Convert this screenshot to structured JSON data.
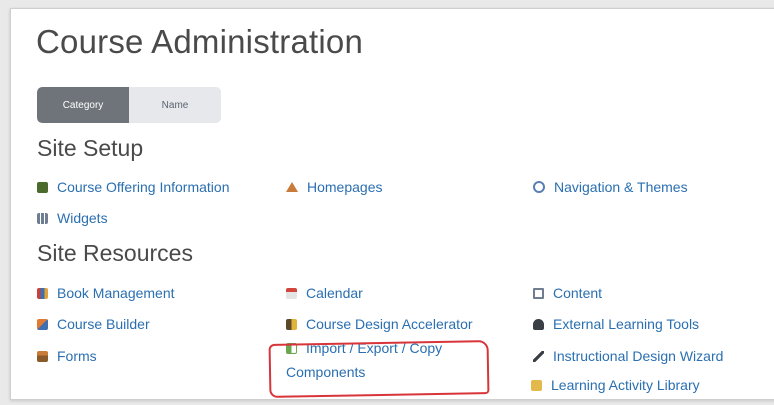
{
  "header": {
    "title": "Course Administration"
  },
  "view_toggle": {
    "category_label": "Category",
    "name_label": "Name",
    "active": "Category"
  },
  "sections": {
    "site_setup": {
      "title": "Site Setup",
      "items": {
        "course_offering": "Course Offering Information",
        "homepages": "Homepages",
        "navigation": "Navigation & Themes",
        "widgets": "Widgets"
      }
    },
    "site_resources": {
      "title": "Site Resources",
      "items": {
        "book_management": "Book Management",
        "calendar": "Calendar",
        "content": "Content",
        "course_builder": "Course Builder",
        "course_design_accelerator": "Course Design Accelerator",
        "external_learning_tools": "External Learning Tools",
        "forms": "Forms",
        "import_export_copy_line1": "Import / Export / Copy",
        "import_export_copy_line2": "Components",
        "instructional_design_wizard": "Instructional Design Wizard",
        "learning_activity_library": "Learning Activity Library"
      }
    }
  },
  "icons": {
    "course_offering": "book-icon",
    "homepages": "home-icon",
    "navigation": "compass-icon",
    "widgets": "grid-icon",
    "book_management": "books-icon",
    "calendar": "calendar-icon",
    "content": "content-icon",
    "course_builder": "builder-icon",
    "course_design_accelerator": "accelerator-icon",
    "external_learning_tools": "tools-icon",
    "forms": "forms-icon",
    "import_export_copy": "import-icon",
    "instructional_design_wizard": "wand-icon",
    "learning_activity_library": "library-icon"
  },
  "colors": {
    "link": "#2a6fb1",
    "heading": "#4a4a4a",
    "highlight": "#d8353a",
    "toggle_active": "#6e7479"
  }
}
